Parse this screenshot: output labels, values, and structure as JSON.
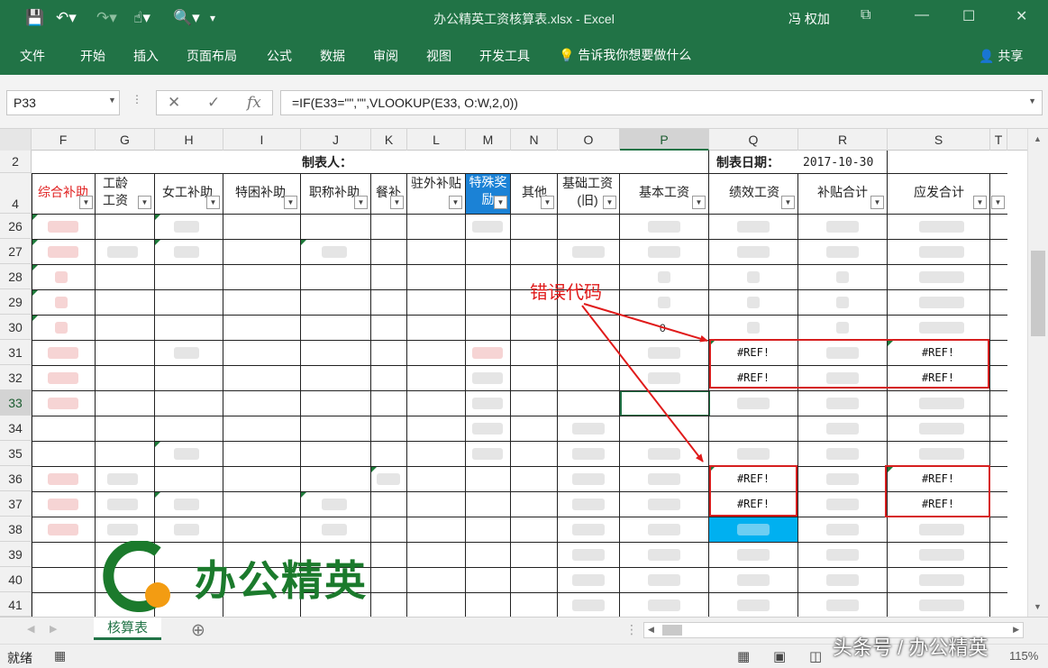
{
  "window": {
    "doc_title": "办公精英工资核算表.xlsx - Excel",
    "user": "冯 权加"
  },
  "ribbon": {
    "tabs": [
      "文件",
      "开始",
      "插入",
      "页面布局",
      "公式",
      "数据",
      "审阅",
      "视图",
      "开发工具"
    ],
    "tell_me": "告诉我你想要做什么",
    "share": "共享"
  },
  "formula_bar": {
    "name_box": "P33",
    "formula": "=IF(E33=\"\",\"\",VLOOKUP(E33,        O:W,2,0))"
  },
  "grid": {
    "columns": [
      "F",
      "G",
      "H",
      "I",
      "J",
      "K",
      "L",
      "M",
      "N",
      "O",
      "P",
      "Q",
      "R",
      "S",
      "T"
    ],
    "rows": [
      "2",
      "4",
      "26",
      "27",
      "28",
      "29",
      "30",
      "31",
      "32",
      "33",
      "34",
      "35",
      "36",
      "37",
      "38",
      "39",
      "40",
      "41"
    ],
    "row2": {
      "preparer_label": "制表人：",
      "date_label": "制表日期：",
      "date_value": "2017-10-30"
    },
    "headers": [
      "综合补助",
      "工龄工资",
      "女工补助",
      "特困补助",
      "职称补助",
      "餐补",
      "驻外补贴",
      "特殊奖励",
      "其他",
      "基础工资(旧)",
      "基本工资",
      "绩效工资",
      "补贴合计",
      "应发合计"
    ],
    "stray_value": "0",
    "error_value": "#REF!"
  },
  "annotation": "错误代码",
  "sheet_tab": "核算表",
  "status": {
    "ready": "就绪",
    "zoom": "115%"
  },
  "watermark": "头条号 / 办公精英",
  "logo_text": "办公精英",
  "colors": {
    "excel_green": "#217346",
    "error_box": "#d61f1f",
    "selected_cell": "#00b0f0",
    "header_highlight": "#1b82d6"
  }
}
